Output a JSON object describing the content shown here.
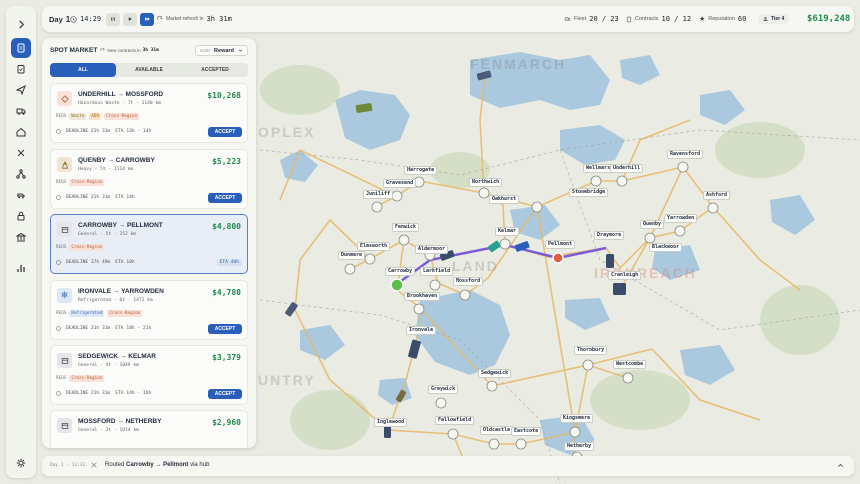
{
  "topbar": {
    "day_label": "Day",
    "day_value": "1",
    "clock": "14:29",
    "refresh_label": "Market refresh in",
    "refresh_time": "3h 31m",
    "fleet_label": "Fleet",
    "fleet_value": "20 / 23",
    "contracts_label": "Contracts",
    "contracts_value": "10 / 12",
    "reputation_label": "Reputation",
    "reputation_value": "60",
    "tier": "Tier 4",
    "money": "$619,248"
  },
  "panel": {
    "title": "SPOT MARKET",
    "new_contracts_label": "New contracts in",
    "new_contracts_time": "3h 31m",
    "sort_label": "SORT",
    "sort_value": "Reward",
    "tabs": [
      "ALL",
      "AVAILABLE",
      "ACCEPTED"
    ]
  },
  "contracts": [
    {
      "route": "UNDERHILL → MOSSFORD",
      "meta": "Hazardous Waste · 7t · 1140 km",
      "price": "$10,268",
      "reqs_label": "REQS",
      "tags": [
        "Waste",
        "ADR",
        "Cross-Region"
      ],
      "deadline": "DEADLINE 21h 31m",
      "eta": "ETA 13h - 14h",
      "action": "ACCEPT"
    },
    {
      "route": "QUENBY → CARROWBY",
      "meta": "Heavy · 5t · 1114 km",
      "price": "$5,223",
      "reqs_label": "REQS",
      "tags": [
        "Cross-Region"
      ],
      "deadline": "DEADLINE 21h 31m",
      "eta": "ETA 14h",
      "action": "ACCEPT"
    },
    {
      "route": "CARROWBY → PELLMONT",
      "meta": "General · 5t · 252 km",
      "price": "$4,800",
      "reqs_label": "REQS",
      "tags": [
        "Cross-Region"
      ],
      "deadline": "DEADLINE 37h 49m",
      "eta": "ETA 10h",
      "action": "ETA 40h"
    },
    {
      "route": "IRONVALE → YARROWDEN",
      "meta": "Refrigerated · 6t · 1471 km",
      "price": "$4,780",
      "reqs_label": "REQS",
      "tags": [
        "Refrigerated",
        "Cross-Region"
      ],
      "deadline": "DEADLINE 21h 31m",
      "eta": "ETA 18h - 21h",
      "action": "ACCEPT"
    },
    {
      "route": "SEDGEWICK → KELMAR",
      "meta": "General · 4t · 1049 km",
      "price": "$3,379",
      "reqs_label": "REQS",
      "tags": [
        "Cross-Region"
      ],
      "deadline": "DEADLINE 21h 31m",
      "eta": "ETA 14h - 16h",
      "action": "ACCEPT"
    },
    {
      "route": "MOSSFORD → NETHERBY",
      "meta": "General · 3t · 1914 km",
      "price": "$2,960",
      "reqs_label": "",
      "tags": [],
      "deadline": "",
      "eta": "",
      "action": ""
    }
  ],
  "log": {
    "time": "Day 1 · 13:31",
    "message_prefix": "Routed",
    "from": "Carrowby",
    "arrow": "→",
    "to": "Pellmont",
    "suffix": "via hub"
  },
  "regions": [
    "FENMARCH",
    "OPLEX",
    "LAND",
    "IRONREACH",
    "UNTRY"
  ],
  "cities": [
    "Harrogate",
    "Northwich",
    "Wellmarsh",
    "Underhill",
    "Ravensford",
    "Gravesend",
    "Juniliff",
    "Oakhurst",
    "Stonebridge",
    "Ashford",
    "Yarrowden",
    "Quenby",
    "Fenwick",
    "Kelmar",
    "Draymore",
    "Elmsworth",
    "Aldermoor",
    "Pellmont",
    "Blackmoor",
    "Dunmere",
    "Carrowby",
    "Larkfield",
    "Cranleigh",
    "Mossford",
    "Brookhaven",
    "Ironvale",
    "Thornbury",
    "Westcombe",
    "Sedgewick",
    "Greywick",
    "Inglewood",
    "Fallowfield",
    "Oldcastle",
    "Eastcote",
    "Kingsmere",
    "Netherby"
  ],
  "colors": {
    "accent": "#2a5ebb",
    "money": "#1f8a4c",
    "route": "#7b5bd6",
    "destination": "#e25b3a",
    "origin": "#5cbd4a"
  }
}
